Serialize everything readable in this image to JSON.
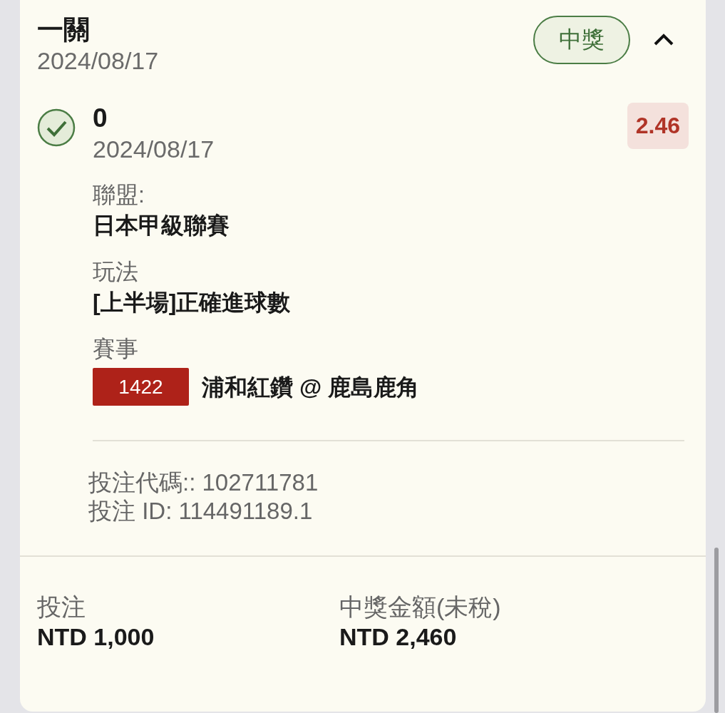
{
  "bet": {
    "title": "一關",
    "date": "2024/08/17",
    "status": {
      "label": "中獎",
      "won": true
    },
    "expanded": true
  },
  "selection": {
    "won": true,
    "pick": "0",
    "date": "2024/08/17",
    "odds": "2.46",
    "fields": [
      {
        "label": "聯盟:",
        "value": "日本甲級聯賽"
      },
      {
        "label": "玩法",
        "value": "[上半場]正確進球數"
      },
      {
        "label": "賽事",
        "code": "1422",
        "value": "浦和紅鑽 @ 鹿島鹿角"
      }
    ]
  },
  "codes": [
    "投注代碼:: 102711781",
    "投注 ID: 114491189.1"
  ],
  "totals": [
    {
      "label": "投注",
      "value": "NTD 1,000"
    },
    {
      "label": "中獎金額(未稅)",
      "value": "NTD 2,460"
    }
  ]
}
